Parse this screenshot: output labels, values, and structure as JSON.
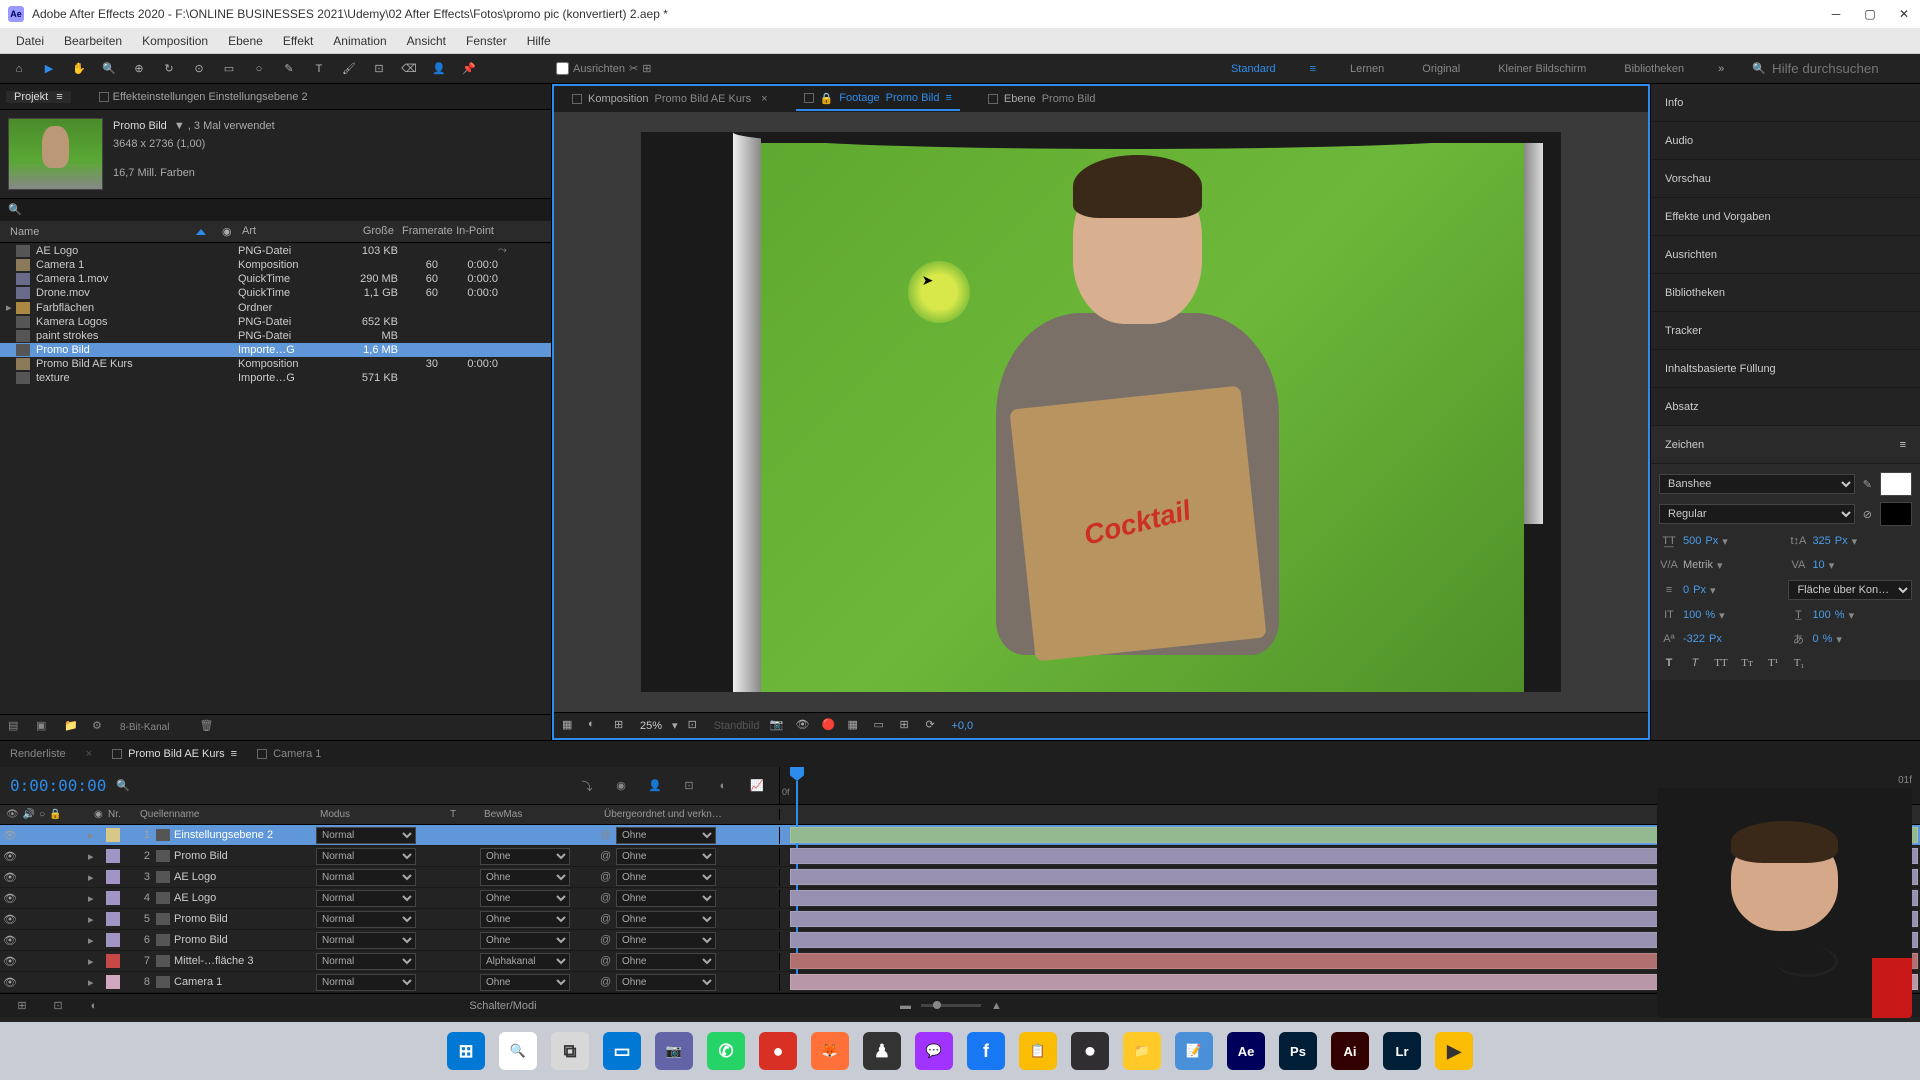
{
  "titlebar": {
    "app": "Adobe After Effects 2020",
    "path": "F:\\ONLINE BUSINESSES 2021\\Udemy\\02 After Effects\\Fotos\\promo pic (konvertiert) 2.aep *"
  },
  "menu": [
    "Datei",
    "Bearbeiten",
    "Komposition",
    "Ebene",
    "Effekt",
    "Animation",
    "Ansicht",
    "Fenster",
    "Hilfe"
  ],
  "toolbar": {
    "align_label": "Ausrichten",
    "workspaces": [
      "Standard",
      "Lernen",
      "Original",
      "Kleiner Bildschirm",
      "Bibliotheken"
    ],
    "active_workspace": "Standard",
    "search_placeholder": "Hilfe durchsuchen"
  },
  "project_panel": {
    "tabs": {
      "projekt": "Projekt",
      "effect_controls": "Effekteinstellungen Einstellungsebene 2"
    },
    "selected": {
      "name": "Promo Bild",
      "usage": ", 3 Mal verwendet",
      "dims": "3648 x 2736 (1,00)",
      "colors": "16,7 Mill. Farben"
    },
    "columns": {
      "name": "Name",
      "art": "Art",
      "size": "Große",
      "framerate": "Framerate",
      "inpoint": "In-Point"
    },
    "rows": [
      {
        "name": "AE Logo",
        "art": "PNG-Datei",
        "size": "103 KB",
        "fr": "",
        "in": "",
        "tag": "#a294c4",
        "icon": "img",
        "flow": true
      },
      {
        "name": "Camera 1",
        "art": "Komposition",
        "size": "",
        "fr": "60",
        "in": "0:00:0",
        "tag": "#baa088",
        "icon": "comp"
      },
      {
        "name": "Camera 1.mov",
        "art": "QuickTime",
        "size": "290 MB",
        "fr": "60",
        "in": "0:00:0",
        "tag": "#a294c4",
        "icon": "mov"
      },
      {
        "name": "Drone.mov",
        "art": "QuickTime",
        "size": "1,1 GB",
        "fr": "60",
        "in": "0:00:0",
        "tag": "#a294c4",
        "icon": "mov"
      },
      {
        "name": "Farbflächen",
        "art": "Ordner",
        "size": "",
        "fr": "",
        "in": "",
        "tag": "#c8c844",
        "icon": "folder",
        "expandable": true
      },
      {
        "name": "Kamera Logos",
        "art": "PNG-Datei",
        "size": "652 KB",
        "fr": "",
        "in": "",
        "tag": "#a294c4",
        "icon": "img"
      },
      {
        "name": "paint strokes",
        "art": "PNG-Datei",
        "size": "MB",
        "fr": "",
        "in": "",
        "tag": "#a294c4",
        "icon": "img"
      },
      {
        "name": "Promo Bild",
        "art": "Importe…G",
        "size": "1,6 MB",
        "fr": "",
        "in": "",
        "tag": "#a294c4",
        "icon": "img",
        "selected": true
      },
      {
        "name": "Promo Bild AE Kurs",
        "art": "Komposition",
        "size": "",
        "fr": "30",
        "in": "0:00:0",
        "tag": "#baa088",
        "icon": "comp"
      },
      {
        "name": "texture",
        "art": "Importe…G",
        "size": "571 KB",
        "fr": "",
        "in": "",
        "tag": "#a294c4",
        "icon": "img"
      }
    ],
    "footer_label": "8-Bit-Kanal"
  },
  "viewer": {
    "tabs": [
      {
        "kind": "Komposition",
        "name": "Promo Bild AE Kurs",
        "closable": true
      },
      {
        "kind": "Footage",
        "name": "Promo Bild",
        "active": true,
        "locked": true
      },
      {
        "kind": "Ebene",
        "name": "Promo Bild"
      }
    ],
    "zoom": "25%",
    "stillframe": "Standbild",
    "exposure": "+0,0"
  },
  "right_panels": {
    "items": [
      "Info",
      "Audio",
      "Vorschau",
      "Effekte und Vorgaben",
      "Ausrichten",
      "Bibliotheken",
      "Tracker",
      "Inhaltsbasierte Füllung",
      "Absatz",
      "Zeichen"
    ],
    "zeichen": {
      "font": "Banshee",
      "style": "Regular",
      "size": "500",
      "size_unit": "Px",
      "leading": "325",
      "leading_unit": "Px",
      "kerning": "Metrik",
      "tracking": "10",
      "stroke": "0",
      "stroke_unit": "Px",
      "stroke_mode": "Fläche über Kon…",
      "vscale": "100",
      "hscale": "100",
      "vscale_unit": "%",
      "hscale_unit": "%",
      "baseline": "-322",
      "baseline_unit": "Px",
      "tsume": "0",
      "tsume_unit": "%"
    }
  },
  "timeline": {
    "tabs": [
      "Renderliste",
      "Promo Bild AE Kurs",
      "Camera 1"
    ],
    "active_tab": 1,
    "timecode": "0:00:00:00",
    "columns": {
      "nr": "Nr.",
      "name": "Quellenname",
      "modus": "Modus",
      "t": "T",
      "bew": "BewMas",
      "parent": "Übergeordnet und verkn…"
    },
    "end_label": "01f",
    "layers": [
      {
        "nr": 1,
        "name": "Einstellungsebene 2",
        "modus": "Normal",
        "bew": "",
        "parent": "Ohne",
        "color": "#d8c888",
        "selected": true,
        "bar": "#94b890"
      },
      {
        "nr": 2,
        "name": "Promo Bild",
        "modus": "Normal",
        "bew": "Ohne",
        "parent": "Ohne",
        "color": "#a294c4",
        "bar": "#9890b0"
      },
      {
        "nr": 3,
        "name": "AE Logo",
        "modus": "Normal",
        "bew": "Ohne",
        "parent": "Ohne",
        "color": "#a294c4",
        "bar": "#9890b0"
      },
      {
        "nr": 4,
        "name": "AE Logo",
        "modus": "Normal",
        "bew": "Ohne",
        "parent": "Ohne",
        "color": "#a294c4",
        "bar": "#9890b0"
      },
      {
        "nr": 5,
        "name": "Promo Bild",
        "modus": "Normal",
        "bew": "Ohne",
        "parent": "Ohne",
        "color": "#a294c4",
        "bar": "#9890b0"
      },
      {
        "nr": 6,
        "name": "Promo Bild",
        "modus": "Normal",
        "bew": "Ohne",
        "parent": "Ohne",
        "color": "#a294c4",
        "bar": "#9890b0"
      },
      {
        "nr": 7,
        "name": "Mittel-…fläche 3",
        "modus": "Normal",
        "bew": "Alphakanal",
        "parent": "Ohne",
        "color": "#c84848",
        "bar": "#b07070"
      },
      {
        "nr": 8,
        "name": "Camera 1",
        "modus": "Normal",
        "bew": "Ohne",
        "parent": "Ohne",
        "color": "#d0a8c0",
        "bar": "#b898a8"
      }
    ],
    "footer": "Schalter/Modi"
  },
  "taskbar": [
    {
      "name": "start",
      "bg": "#0078d4",
      "glyph": "⊞"
    },
    {
      "name": "search",
      "bg": "#ffffff",
      "glyph": "🔍"
    },
    {
      "name": "task-view",
      "bg": "#d8d8d8",
      "glyph": "⧉"
    },
    {
      "name": "app1",
      "bg": "#0078d4",
      "glyph": "▭"
    },
    {
      "name": "teams",
      "bg": "#6264a7",
      "glyph": "📷"
    },
    {
      "name": "whatsapp",
      "bg": "#25d366",
      "glyph": "✆"
    },
    {
      "name": "app2",
      "bg": "#d93025",
      "glyph": "●"
    },
    {
      "name": "firefox",
      "bg": "#ff7139",
      "glyph": "🦊"
    },
    {
      "name": "app3",
      "bg": "#333333",
      "glyph": "♟"
    },
    {
      "name": "messenger",
      "bg": "#a033ff",
      "glyph": "💬"
    },
    {
      "name": "facebook",
      "bg": "#1877f2",
      "glyph": "f"
    },
    {
      "name": "app4",
      "bg": "#fbbc04",
      "glyph": "📋"
    },
    {
      "name": "obs",
      "bg": "#302e31",
      "glyph": "⏺"
    },
    {
      "name": "explorer",
      "bg": "#ffca28",
      "glyph": "📁"
    },
    {
      "name": "notepad",
      "bg": "#4a90d9",
      "glyph": "📝"
    },
    {
      "name": "after-effects",
      "bg": "#00005b",
      "glyph": "Ae"
    },
    {
      "name": "photoshop",
      "bg": "#001e36",
      "glyph": "Ps"
    },
    {
      "name": "illustrator",
      "bg": "#330000",
      "glyph": "Ai"
    },
    {
      "name": "lightroom",
      "bg": "#001e36",
      "glyph": "Lr"
    },
    {
      "name": "app5",
      "bg": "#fbbc04",
      "glyph": "▶"
    }
  ]
}
